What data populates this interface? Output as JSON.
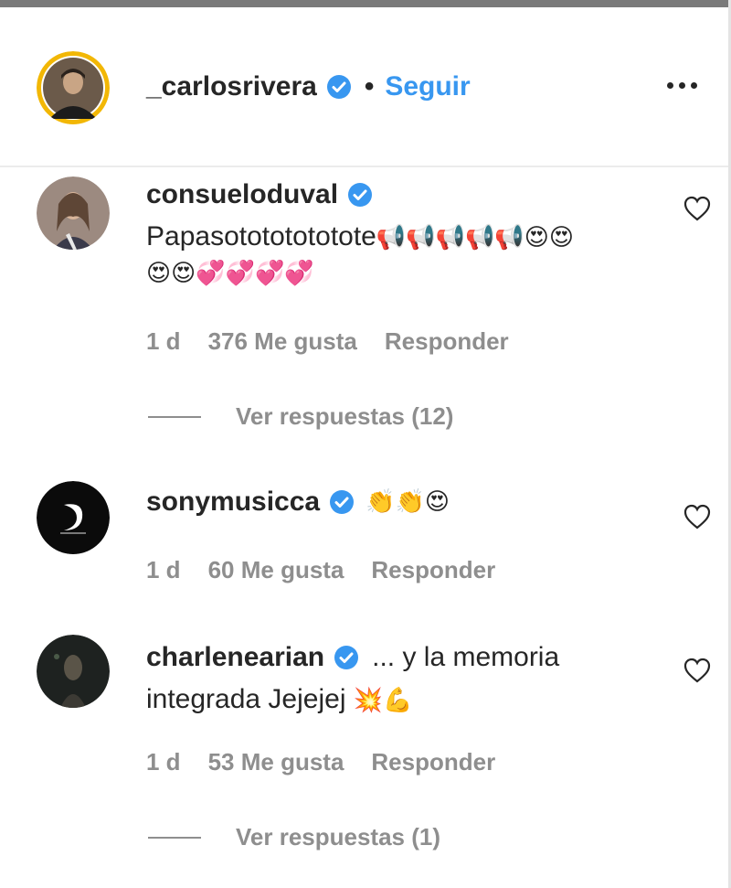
{
  "post": {
    "author": "_carlosrivera",
    "separator": "•",
    "follow_label": "Seguir"
  },
  "comments": [
    {
      "username": "consueloduval",
      "text": "Papasotototototote",
      "emoji_line1": "📢📢📢📢📢😍😍",
      "emoji_line2": "😍😍💞💞💞💞",
      "time": "1 d",
      "likes": "376 Me gusta",
      "reply_label": "Responder",
      "view_replies": "Ver respuestas (12)"
    },
    {
      "username": "sonymusicca",
      "text": "",
      "emoji_line1": "👏👏😍",
      "time": "1 d",
      "likes": "60 Me gusta",
      "reply_label": "Responder"
    },
    {
      "username": "charlenearian",
      "text": "... y la memoria",
      "text_line2": "integrada Jejejej",
      "emoji_line2": "💥💪",
      "time": "1 d",
      "likes": "53 Me gusta",
      "reply_label": "Responder",
      "view_replies": "Ver respuestas (1)"
    }
  ],
  "colors": {
    "link_blue": "#3897f0",
    "secondary_text": "#8e8e8e",
    "verified_blue": "#3897f0"
  },
  "icons": [
    "verified-icon",
    "heart-icon",
    "more-options-icon"
  ]
}
